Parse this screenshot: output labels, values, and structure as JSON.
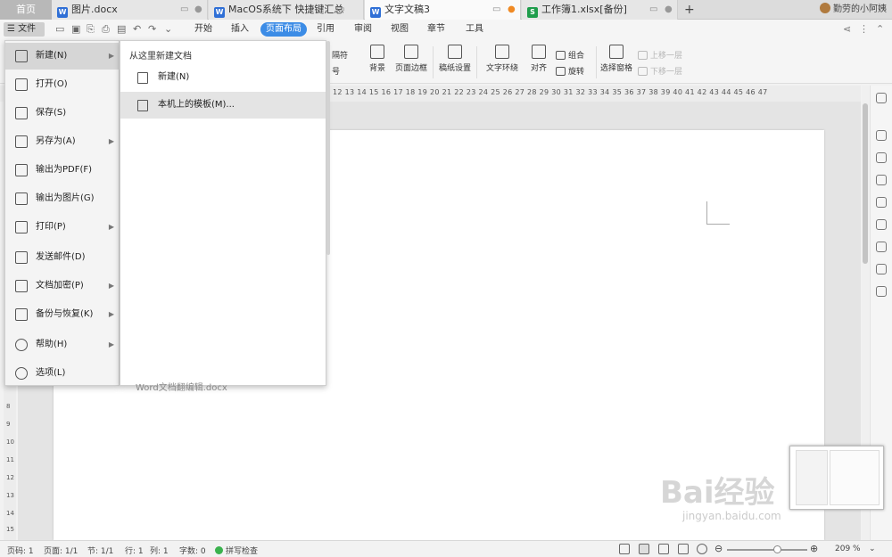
{
  "tabs": {
    "home": "首页",
    "items": [
      {
        "label": "图片.docx",
        "type": "W"
      },
      {
        "label": "MacOS系统下 快捷键汇总",
        "type": "W"
      },
      {
        "label": "文字文稿3",
        "type": "W"
      },
      {
        "label": "工作簿1.xlsx[备份]",
        "type": "S"
      }
    ],
    "add": "+",
    "user": "勤劳的小阿姨"
  },
  "menubar": {
    "file": "文件",
    "tabs": [
      "开始",
      "插入",
      "页面布局",
      "引用",
      "审阅",
      "视图",
      "章节",
      "工具"
    ],
    "active": "页面布局"
  },
  "ribbon": {
    "partial1": "隔符",
    "partial2": "号",
    "background": "背景",
    "page_border": "页面边框",
    "draft": "稿纸设置",
    "wrap": "文字环绕",
    "align": "对齐",
    "group": "组合",
    "rotate": "旋转",
    "selection_pane": "选择窗格",
    "bring_forward": "上移一层",
    "send_backward": "下移一层"
  },
  "ruler": {
    "numbers": "12 13 14 15 16 17 18 19 20 21 22 23 24 25 26 27 28 29 30 31 32 33 34 35 36 37 38 39 40 41 42 43 44 45 46 47"
  },
  "vruler": [
    "8",
    "9",
    "10",
    "11",
    "12",
    "13",
    "14",
    "15"
  ],
  "file_menu": {
    "items": [
      {
        "label": "新建(N)",
        "arrow": true,
        "selected": true
      },
      {
        "label": "打开(O)",
        "arrow": false
      },
      {
        "label": "保存(S)",
        "arrow": false
      },
      {
        "label": "另存为(A)",
        "arrow": true
      },
      {
        "label": "输出为PDF(F)",
        "arrow": false
      },
      {
        "label": "输出为图片(G)",
        "arrow": false
      },
      {
        "label": "打印(P)",
        "arrow": true
      },
      {
        "label": "发送邮件(D)",
        "arrow": false
      },
      {
        "label": "文档加密(P)",
        "arrow": true
      },
      {
        "label": "备份与恢复(K)",
        "arrow": true
      },
      {
        "label": "帮助(H)",
        "arrow": true
      },
      {
        "label": "选项(L)",
        "arrow": false
      }
    ]
  },
  "submenu": {
    "title": "从这里新建文档",
    "items": [
      {
        "label": "新建(N)"
      },
      {
        "label": "本机上的模板(M)..."
      }
    ],
    "peek_file": "Word文档翻编辑.docx"
  },
  "statusbar": {
    "page_no": "页码: 1",
    "pages": "页面: 1/1",
    "section": "节: 1/1",
    "row": "行: 1",
    "col": "列: 1",
    "words": "字数: 0",
    "spell": "拼写检查",
    "zoom": "209 %"
  },
  "watermark": {
    "main": "Bai经验",
    "sub": "jingyan.baidu.com"
  },
  "colors": {
    "accent": "#3c8ce6",
    "word": "#2f6fd6",
    "sheet": "#1f9d4c"
  }
}
